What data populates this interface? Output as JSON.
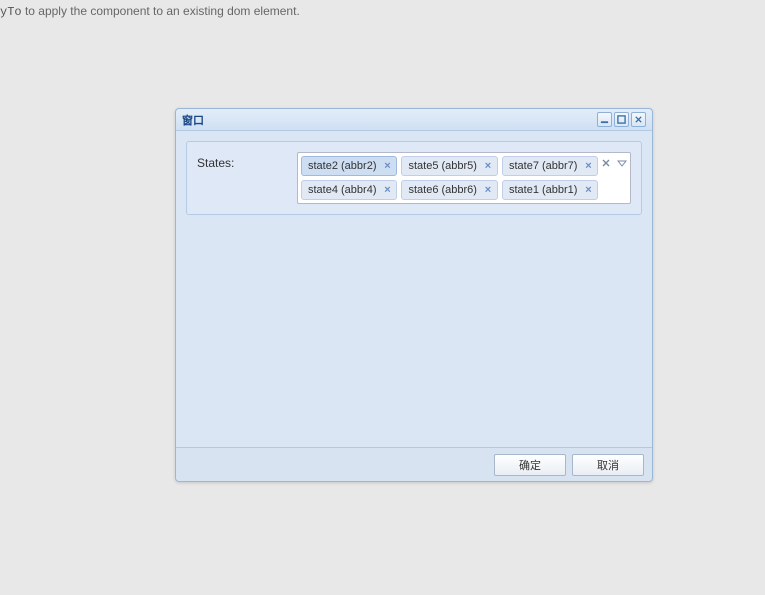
{
  "topText": {
    "code": "yTo",
    "rest": " to apply the component to an existing dom element."
  },
  "window": {
    "title": "窗口",
    "form": {
      "fieldLabel": "States:",
      "tags": [
        {
          "label": "state2 (abbr2)",
          "selected": true
        },
        {
          "label": "state5 (abbr5)",
          "selected": false
        },
        {
          "label": "state7 (abbr7)",
          "selected": false
        },
        {
          "label": "state4 (abbr4)",
          "selected": false
        },
        {
          "label": "state6 (abbr6)",
          "selected": false
        },
        {
          "label": "state1 (abbr1)",
          "selected": false
        }
      ]
    },
    "buttons": {
      "ok": "确定",
      "cancel": "取消"
    }
  }
}
